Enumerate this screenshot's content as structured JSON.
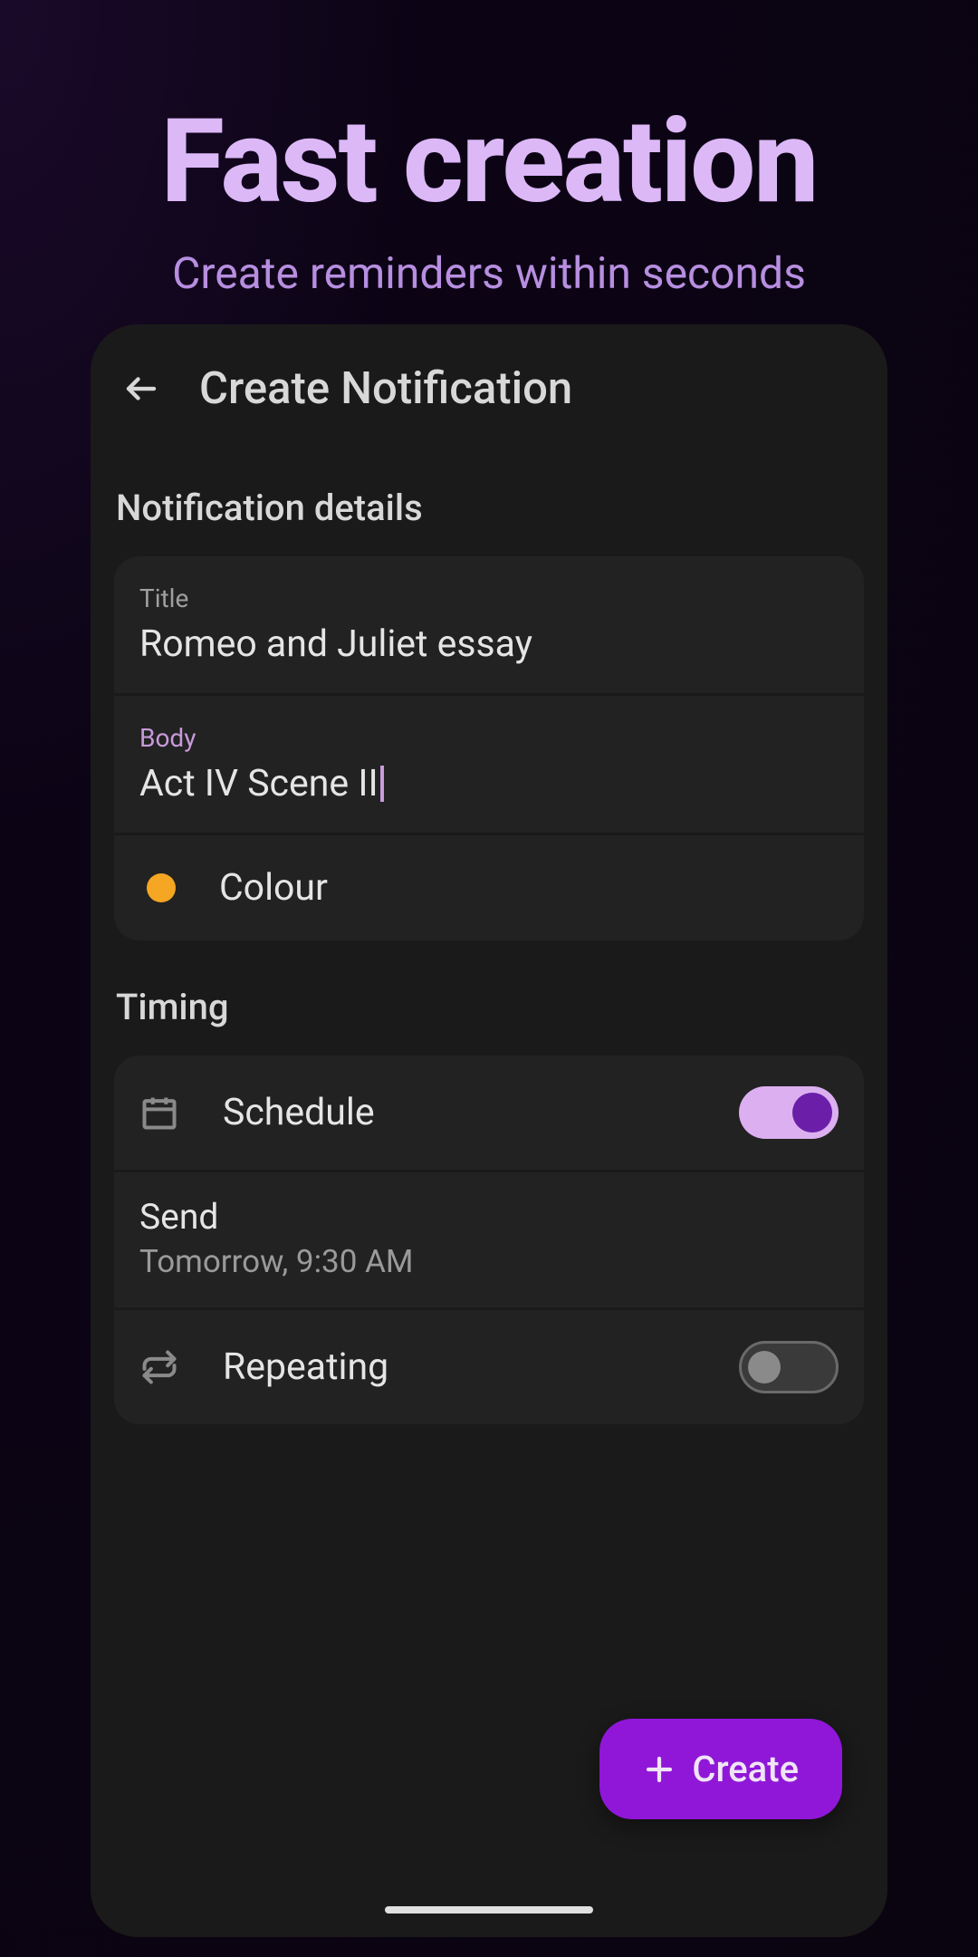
{
  "hero": {
    "title": "Fast creation",
    "subtitle": "Create reminders within seconds"
  },
  "header": {
    "title": "Create Notification"
  },
  "sections": {
    "details_label": "Notification details",
    "timing_label": "Timing"
  },
  "details": {
    "title_label": "Title",
    "title_value": "Romeo and Juliet essay",
    "body_label": "Body",
    "body_value": "Act IV Scene II",
    "colour_label": "Colour",
    "colour_value": "#f5a623"
  },
  "timing": {
    "schedule_label": "Schedule",
    "schedule_on": true,
    "send_label": "Send",
    "send_value": "Tomorrow, 9:30 AM",
    "repeating_label": "Repeating",
    "repeating_on": false
  },
  "actions": {
    "create_label": "Create"
  }
}
